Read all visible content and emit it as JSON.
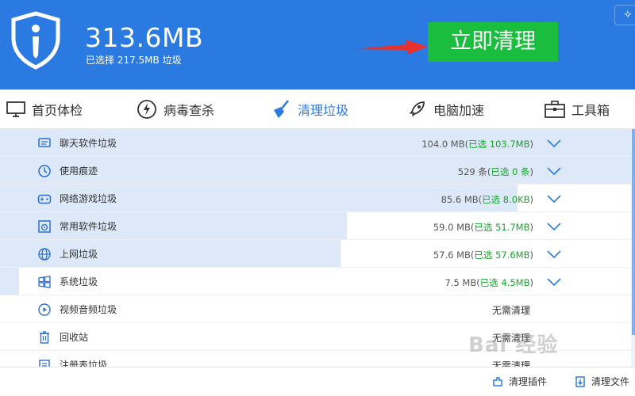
{
  "header": {
    "total_size": "313.6MB",
    "selected_text": "已选择 217.5MB 垃圾",
    "clean_button": "立即清理",
    "corner_icon": "sparkle-icon"
  },
  "tabs": [
    {
      "label": "首页体检",
      "icon": "monitor-icon",
      "active": false
    },
    {
      "label": "病毒查杀",
      "icon": "shield-bolt-icon",
      "active": false
    },
    {
      "label": "清理垃圾",
      "icon": "broom-icon",
      "active": true
    },
    {
      "label": "电脑加速",
      "icon": "rocket-icon",
      "active": false
    },
    {
      "label": "工具箱",
      "icon": "toolbox-icon",
      "active": false
    }
  ],
  "items": [
    {
      "name": "聊天软件垃圾",
      "icon": "chat-icon",
      "size": "104.0 MB(",
      "selected": "已选 103.7MB",
      "close": ")",
      "fill": 1.0
    },
    {
      "name": "使用痕迹",
      "icon": "clock-icon",
      "size": "529 条(",
      "selected": "已选 0 条",
      "close": ")",
      "fill": 1.0
    },
    {
      "name": "网络游戏垃圾",
      "icon": "gamepad-icon",
      "size": "85.6 MB(",
      "selected": "已选 8.0KB",
      "close": ")",
      "fill": 0.82
    },
    {
      "name": "常用软件垃圾",
      "icon": "disc-box-icon",
      "size": "59.0 MB(",
      "selected": "已选 51.7MB",
      "close": ")",
      "fill": 0.55
    },
    {
      "name": "上网垃圾",
      "icon": "globe-icon",
      "size": "57.6 MB(",
      "selected": "已选 57.6MB",
      "close": ")",
      "fill": 0.54
    },
    {
      "name": "系统垃圾",
      "icon": "windows-icon",
      "size": "7.5 MB(",
      "selected": "已选 4.5MB",
      "close": ")",
      "fill": 0.03
    },
    {
      "name": "视频音频垃圾",
      "icon": "play-icon",
      "status": "无需清理"
    },
    {
      "name": "回收站",
      "icon": "trash-icon",
      "status": "无需清理"
    },
    {
      "name": "注册表垃圾",
      "icon": "registry-icon",
      "status": "无需清理"
    }
  ],
  "footer": {
    "clean_plugins": "清理插件",
    "clean_files": "清理文件"
  },
  "watermark": "Bai 经验"
}
